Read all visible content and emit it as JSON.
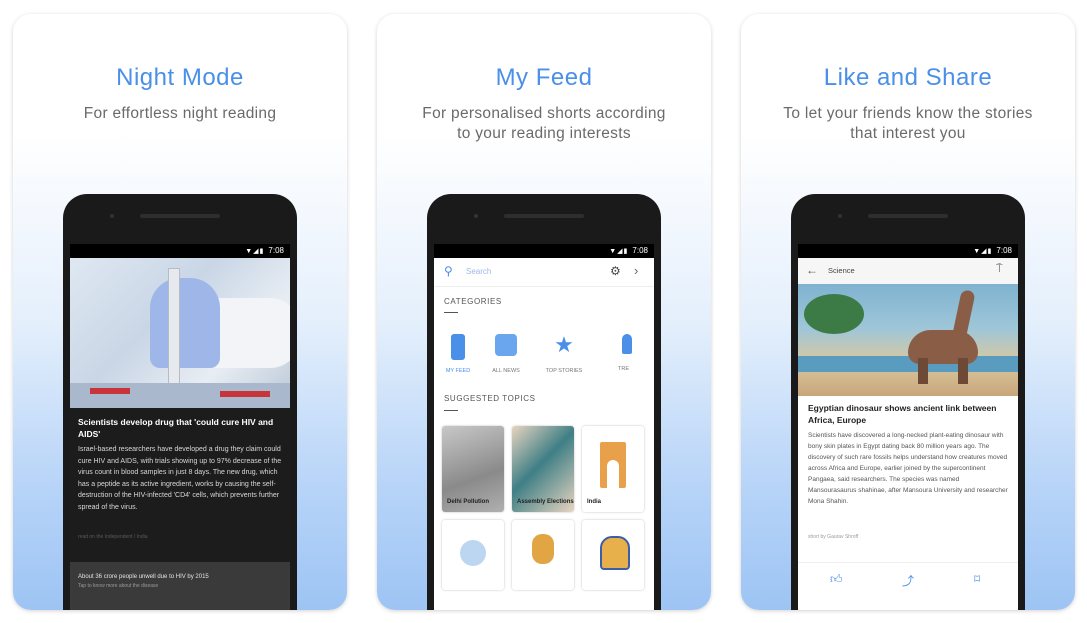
{
  "cards": [
    {
      "title": "Night Mode",
      "subtitle": "For effortless night reading"
    },
    {
      "title": "My Feed",
      "subtitle": "For personalised shorts according to your reading interests"
    },
    {
      "title": "Like and Share",
      "subtitle": "To let your friends know the stories that interest you"
    }
  ],
  "status_time": "7:08",
  "night": {
    "headline": "Scientists develop drug that 'could cure HIV and AIDS'",
    "body": "Israel-based researchers have developed a drug they claim could cure HIV and AIDS, with trials showing up to 97% decrease of the virus count in blood samples in just 8 days. The new drug, which has a peptide as its active ingredient, works by causing the self-destruction of the HIV-infected 'CD4' cells, which prevents further spread of the virus.",
    "source": "read on the Independent / India",
    "footer_title": "About 36 crore people unwell due to HIV by 2015",
    "footer_sub": "Tap to know more about the disease"
  },
  "feed": {
    "search_placeholder": "Search",
    "categories_label": "CATEGORIES",
    "categories": [
      {
        "label": "MY FEED",
        "icon": "phone-icon",
        "color": "#4a8fe8"
      },
      {
        "label": "ALL NEWS",
        "icon": "news-icon",
        "color": "#5a9ae8"
      },
      {
        "label": "TOP STORIES",
        "icon": "star-icon",
        "color": "#4a8fe8"
      },
      {
        "label": "TRE",
        "icon": "flame-icon",
        "color": "#4a8fe8"
      }
    ],
    "suggested_label": "SUGGESTED TOPICS",
    "topics": [
      "Delhi Pollution",
      "Assembly Elections",
      "India"
    ]
  },
  "share": {
    "top_label": "Science",
    "headline": "Egyptian dinosaur shows ancient link between Africa, Europe",
    "body": "Scientists have discovered a long-necked plant-eating dinosaur with bony skin plates in Egypt dating back 80 million years ago. The discovery of such rare fossils helps understand how creatures moved across Africa and Europe, earlier joined by the supercontinent Pangaea, said researchers. The species was named Mansourasaurus shahinae, after Mansoura University and researcher Mona Shahin.",
    "source": "short by Gaurav Shroff"
  }
}
